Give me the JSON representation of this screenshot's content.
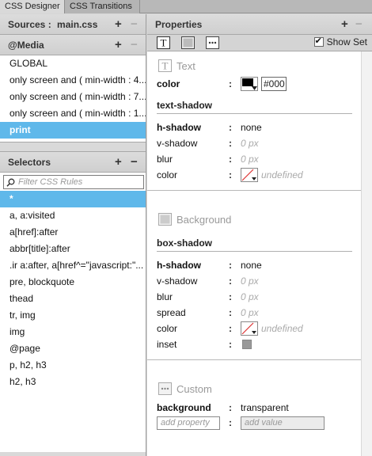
{
  "tabs": [
    {
      "label": "CSS Designer",
      "active": true
    },
    {
      "label": "CSS Transitions",
      "active": false
    }
  ],
  "sources": {
    "title": "Sources :",
    "file": "main.css"
  },
  "media": {
    "title": "@Media",
    "items": [
      "GLOBAL",
      "only screen and ( min-width : 4...",
      "only screen and ( min-width : 7...",
      "only screen and ( min-width : 1...",
      "print"
    ],
    "selected_index": 4
  },
  "selectors": {
    "title": "Selectors",
    "filter_placeholder": "Filter CSS Rules",
    "items": [
      "*",
      "a, a:visited",
      "a[href]:after",
      "abbr[title]:after",
      ".ir a:after, a[href^=\"javascript:\"...",
      "pre, blockquote",
      "thead",
      "tr, img",
      "img",
      "@page",
      "p, h2, h3",
      "h2, h3"
    ],
    "selected_index": 0
  },
  "properties": {
    "title": "Properties",
    "show_set_label": "Show Set",
    "show_set_checked": true,
    "text": {
      "title": "Text",
      "color_label": "color",
      "color_value": "#000",
      "text_shadow_title": "text-shadow",
      "h_shadow_label": "h-shadow",
      "h_shadow_value": "none",
      "v_shadow_label": "v-shadow",
      "v_shadow_value": "0 px",
      "blur_label": "blur",
      "blur_value": "0 px",
      "shadow_color_label": "color",
      "shadow_color_value": "undefined"
    },
    "background": {
      "title": "Background",
      "box_shadow_title": "box-shadow",
      "h_shadow_label": "h-shadow",
      "h_shadow_value": "none",
      "v_shadow_label": "v-shadow",
      "v_shadow_value": "0 px",
      "blur_label": "blur",
      "blur_value": "0 px",
      "spread_label": "spread",
      "spread_value": "0 px",
      "color_label": "color",
      "color_value": "undefined",
      "inset_label": "inset"
    },
    "custom": {
      "title": "Custom",
      "background_label": "background",
      "background_value": "transparent",
      "add_property_placeholder": "add property",
      "add_value_placeholder": "add value"
    }
  },
  "icons": {
    "add": "+",
    "remove": "−",
    "colon": ":"
  },
  "colors": {
    "selection": "#5fb8ea",
    "panel_bg": "#d9d9d9",
    "muted_text": "#aaaaaa"
  }
}
